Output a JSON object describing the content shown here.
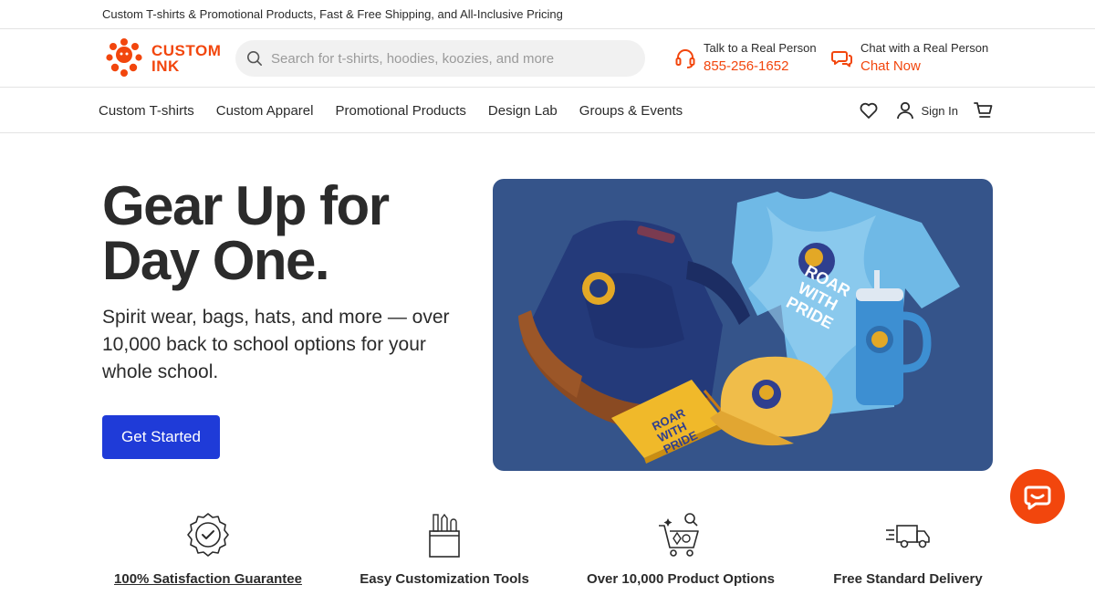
{
  "promo_bar": {
    "text": "Custom T-shirts & Promotional Products, Fast & Free Shipping, and All-Inclusive Pricing"
  },
  "header": {
    "logo": {
      "line1": "CUSTOM",
      "line2": "INK"
    },
    "search": {
      "placeholder": "Search for t-shirts, hoodies, koozies, and more",
      "value": ""
    },
    "phone": {
      "label": "Talk to a Real Person",
      "number": "855-256-1652",
      "icon": "headset-icon"
    },
    "chat": {
      "label": "Chat with a Real Person",
      "action": "Chat Now",
      "icon": "chat-bubbles-icon"
    }
  },
  "nav": {
    "items": [
      "Custom T-shirts",
      "Custom Apparel",
      "Promotional Products",
      "Design Lab",
      "Groups & Events"
    ],
    "sign_in": "Sign In"
  },
  "hero": {
    "title": "Gear Up for Day One.",
    "subtitle": "Spirit wear, bags, hats, and more — over 10,000 back to school options for your whole school.",
    "cta": "Get Started",
    "image_text": "ROAR WITH PRIDE"
  },
  "features": [
    {
      "label": "100% Satisfaction Guarantee",
      "icon": "badge-check-icon"
    },
    {
      "label": "Easy Customization Tools",
      "icon": "tools-cup-icon"
    },
    {
      "label": "Over 10,000 Product Options",
      "icon": "shopping-cart-icon"
    },
    {
      "label": "Free Standard Delivery",
      "icon": "delivery-truck-icon"
    }
  ],
  "colors": {
    "brand_orange": "#f2460d",
    "cta_blue": "#1f3bd8",
    "hero_bg": "#35548a"
  }
}
